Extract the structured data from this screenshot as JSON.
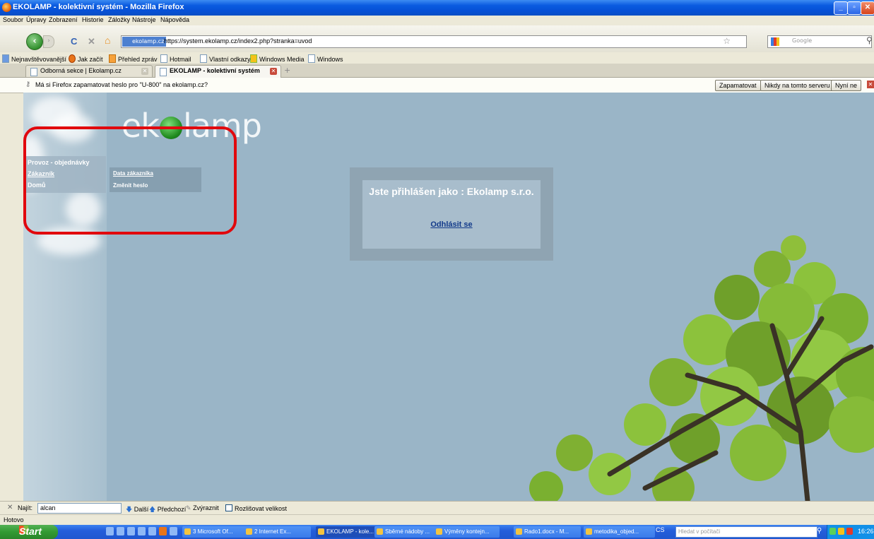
{
  "window": {
    "title": "EKOLAMP - kolektivní systém - Mozilla Firefox",
    "min": "_",
    "max": "▫",
    "close": "✕"
  },
  "menu": [
    "Soubor",
    "Úpravy",
    "Zobrazení",
    "Historie",
    "Záložky",
    "Nástroje",
    "Nápověda"
  ],
  "nav": {
    "site_badge": "ekolamp.cz",
    "url": "https://system.ekolamp.cz/index2.php?stranka=uvod",
    "search_placeholder": "Google",
    "back": "‹",
    "forward": "›",
    "reload": "C",
    "stop": "✕",
    "home": "⌂"
  },
  "bookmarks": [
    "Nejnavštěvovanější",
    "Jak začít",
    "Přehled zpráv",
    "Hotmail",
    "Vlastní odkazy",
    "Windows Media",
    "Windows"
  ],
  "tabs": [
    {
      "label": "Odborná sekce | Ekolamp.cz"
    },
    {
      "label": "EKOLAMP - kolektivní systém"
    }
  ],
  "notification": {
    "message": "Má si Firefox zapamatovat heslo pro \"U-800\" na ekolamp.cz?",
    "btn_remember": "Zapamatovat",
    "btn_never": "Nikdy na tomto serveru",
    "btn_notnow": "Nyní ne"
  },
  "page": {
    "logo_left": "ek",
    "logo_right": "lamp",
    "menu": {
      "item1": "Provoz - objednávky",
      "item2": "Zákazník",
      "item3": "Domů",
      "sub1": "Data zákazníka",
      "sub2": "Změnit heslo"
    },
    "login_text": "Jste přihlášen jako : Ekolamp s.r.o.",
    "logout": "Odhlásit se"
  },
  "findbar": {
    "close": "✕",
    "label": "Najít:",
    "value": "alcan",
    "next": "Další",
    "prev": "Předchozí",
    "highlight": "Zvýraznit",
    "matchcase": "Rozlišovat velikost"
  },
  "status": "Hotovo",
  "taskbar": {
    "start": "Start",
    "tasks": [
      "3 Microsoft Of...",
      "2 Internet Ex...",
      "EKOLAMP - kole...",
      "Sběrné nádoby ...",
      "Výměny kontejn...",
      "Rado1.docx - M...",
      "metodika_objed..."
    ],
    "lang": "CS",
    "search_placeholder": "Hledat v počítači",
    "clock": "16:26"
  },
  "colors": {
    "page_bg": "#9ab5c7",
    "highlight_frame": "#e1080d",
    "link": "#123a8a"
  }
}
